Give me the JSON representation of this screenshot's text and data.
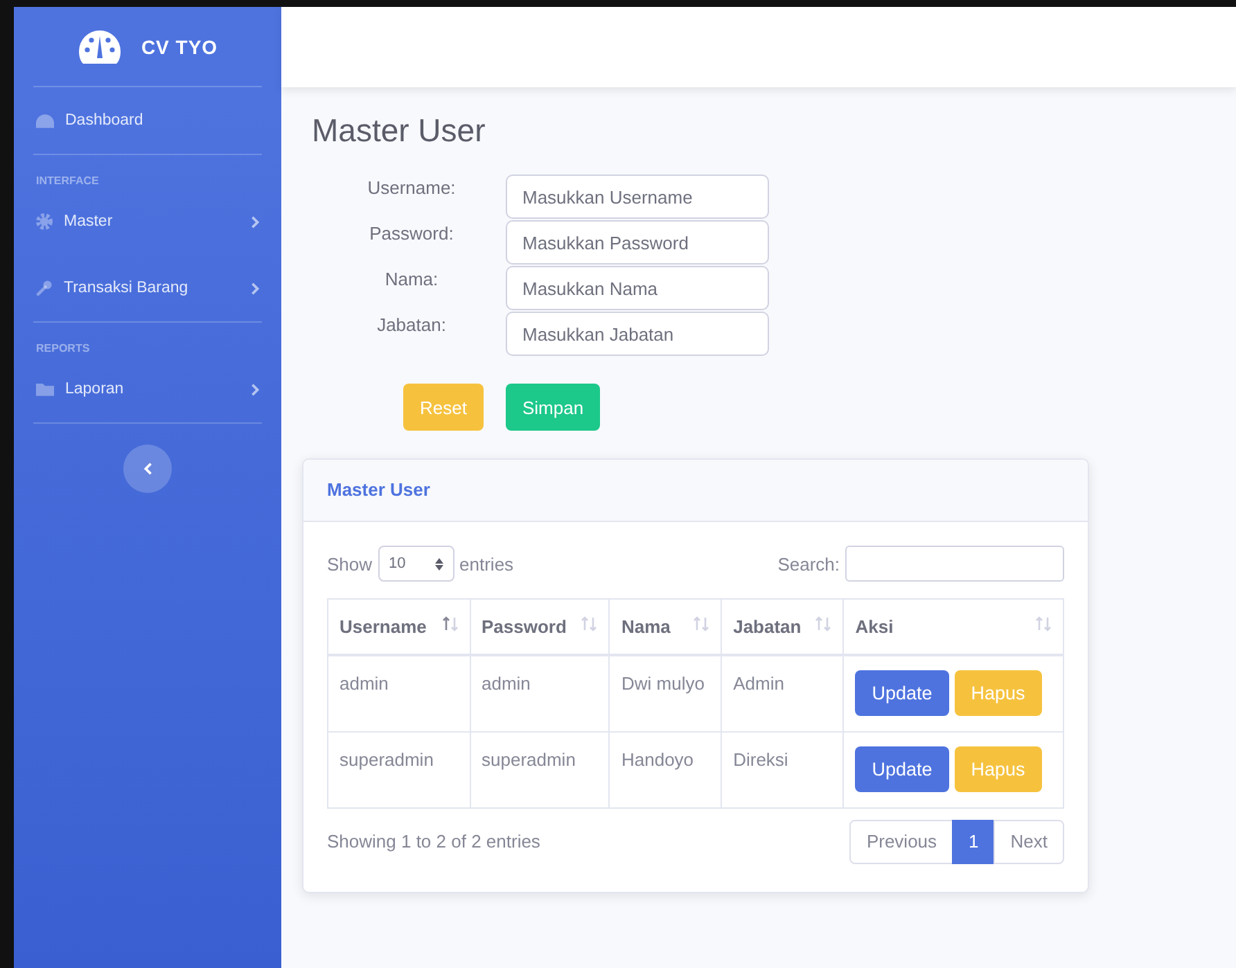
{
  "brand": {
    "name": "CV TYO"
  },
  "sidebar": {
    "items": [
      {
        "kind": "link",
        "label": "Dashboard"
      },
      {
        "kind": "heading",
        "label": "INTERFACE"
      },
      {
        "kind": "menu",
        "label": "Master"
      },
      {
        "kind": "menu",
        "label": "Transaksi Barang"
      },
      {
        "kind": "heading",
        "label": "REPORTS"
      },
      {
        "kind": "menu",
        "label": "Laporan"
      }
    ]
  },
  "page_title": "Master User",
  "form": {
    "fields": [
      {
        "label": "Username:",
        "placeholder": "Masukkan Username"
      },
      {
        "label": "Password:",
        "placeholder": "Masukkan Password"
      },
      {
        "label": "Nama:",
        "placeholder": "Masukkan Nama"
      },
      {
        "label": "Jabatan:",
        "placeholder": "Masukkan Jabatan"
      }
    ],
    "buttons": [
      {
        "kind": "warning",
        "label": "Reset"
      },
      {
        "kind": "success",
        "label": "Simpan"
      }
    ]
  },
  "card": {
    "title": "Master User",
    "length": {
      "before": "Show",
      "value": "10",
      "after": "entries"
    },
    "search_label": "Search:",
    "table": {
      "columns": [
        {
          "label": "Username",
          "sorted": true
        },
        {
          "label": "Password",
          "sorted": false
        },
        {
          "label": "Nama",
          "sorted": false
        },
        {
          "label": "Jabatan",
          "sorted": false
        },
        {
          "label": "Aksi",
          "sorted": false
        }
      ],
      "rows": [
        {
          "cells": [
            "admin",
            "admin",
            "Dwi mulyo",
            "Admin"
          ],
          "actions": [
            {
              "kind": "primary",
              "label": "Update"
            },
            {
              "kind": "warning",
              "label": "Hapus"
            }
          ]
        },
        {
          "cells": [
            "superadmin",
            "superadmin",
            "Handoyo",
            "Direksi"
          ],
          "actions": [
            {
              "kind": "primary",
              "label": "Update"
            },
            {
              "kind": "warning",
              "label": "Hapus"
            }
          ]
        }
      ]
    },
    "info": "Showing 1 to 2 of 2 entries",
    "pagination": [
      {
        "label": "Previous",
        "selected": false
      },
      {
        "label": "1",
        "selected": true
      },
      {
        "label": "Next",
        "selected": false
      }
    ]
  }
}
